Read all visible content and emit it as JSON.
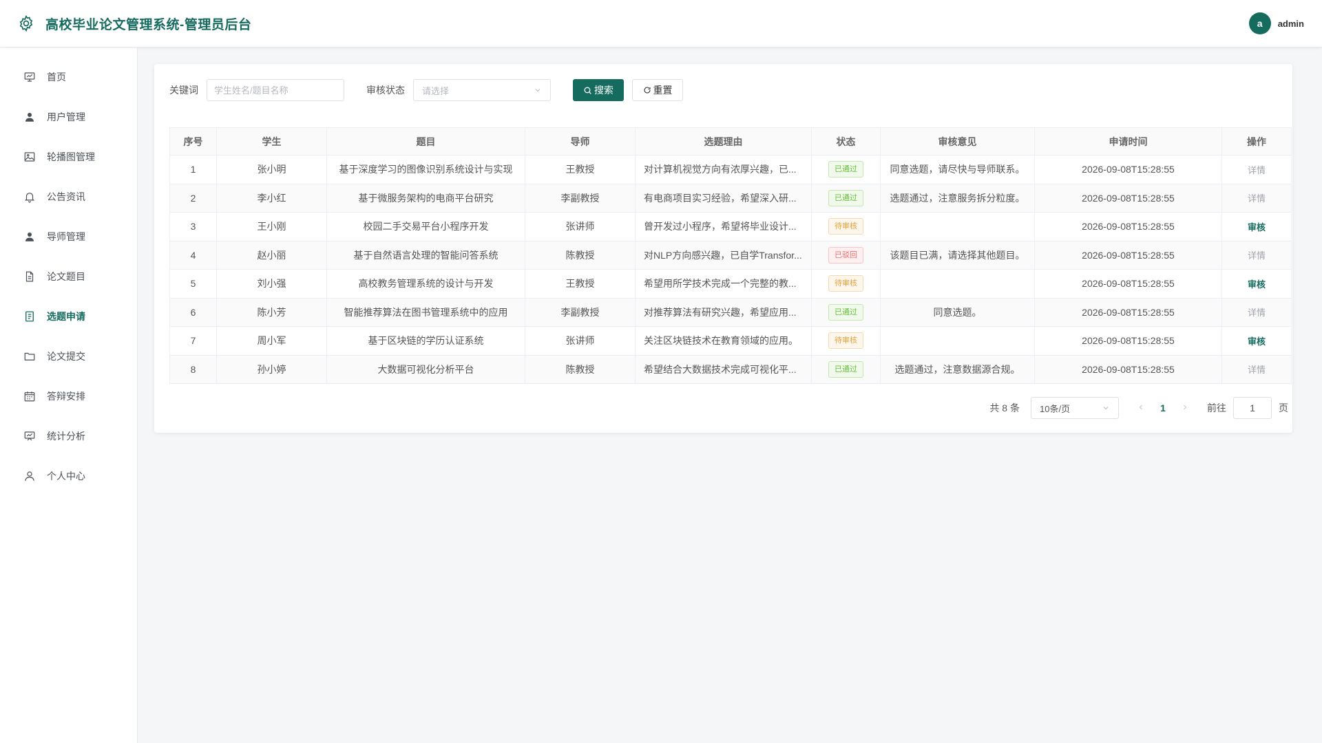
{
  "header": {
    "title": "高校毕业论文管理系统-管理员后台",
    "avatar_letter": "a",
    "username": "admin"
  },
  "sidebar": {
    "items": [
      {
        "label": "首页",
        "icon": "monitor-icon"
      },
      {
        "label": "用户管理",
        "icon": "user-icon"
      },
      {
        "label": "轮播图管理",
        "icon": "picture-icon"
      },
      {
        "label": "公告资讯",
        "icon": "bell-icon"
      },
      {
        "label": "导师管理",
        "icon": "user-icon"
      },
      {
        "label": "论文题目",
        "icon": "document-icon"
      },
      {
        "label": "选题申请",
        "icon": "list-document-icon",
        "active": true
      },
      {
        "label": "论文提交",
        "icon": "folder-icon"
      },
      {
        "label": "答辩安排",
        "icon": "calendar-icon"
      },
      {
        "label": "统计分析",
        "icon": "chart-board-icon"
      },
      {
        "label": "个人中心",
        "icon": "person-icon"
      }
    ]
  },
  "filters": {
    "keyword_label": "关键词",
    "keyword_placeholder": "学生姓名/题目名称",
    "keyword_value": "",
    "status_label": "审核状态",
    "status_placeholder": "请选择",
    "search_label": "搜索",
    "reset_label": "重置"
  },
  "table": {
    "columns": [
      "序号",
      "学生",
      "题目",
      "导师",
      "选题理由",
      "状态",
      "审核意见",
      "申请时间",
      "操作"
    ],
    "rows": [
      {
        "no": "1",
        "student": "张小明",
        "topic": "基于深度学习的图像识别系统设计与实现",
        "advisor": "王教授",
        "reason": "对计算机视觉方向有浓厚兴趣，已...",
        "status": "已通过",
        "status_type": "ok",
        "opinion": "同意选题，请尽快与导师联系。",
        "time": "2026-09-08T15:28:55",
        "action": "详情",
        "action_type": "detail"
      },
      {
        "no": "2",
        "student": "李小红",
        "topic": "基于微服务架构的电商平台研究",
        "advisor": "李副教授",
        "reason": "有电商项目实习经验，希望深入研...",
        "status": "已通过",
        "status_type": "ok",
        "opinion": "选题通过，注意服务拆分粒度。",
        "time": "2026-09-08T15:28:55",
        "action": "详情",
        "action_type": "detail"
      },
      {
        "no": "3",
        "student": "王小刚",
        "topic": "校园二手交易平台小程序开发",
        "advisor": "张讲师",
        "reason": "曾开发过小程序，希望将毕业设计...",
        "status": "待审核",
        "status_type": "wait",
        "opinion": "",
        "time": "2026-09-08T15:28:55",
        "action": "审核",
        "action_type": "review"
      },
      {
        "no": "4",
        "student": "赵小丽",
        "topic": "基于自然语言处理的智能问答系统",
        "advisor": "陈教授",
        "reason": "对NLP方向感兴趣，已自学Transfor...",
        "status": "已驳回",
        "status_type": "rej",
        "opinion": "该题目已满，请选择其他题目。",
        "time": "2026-09-08T15:28:55",
        "action": "详情",
        "action_type": "detail"
      },
      {
        "no": "5",
        "student": "刘小强",
        "topic": "高校教务管理系统的设计与开发",
        "advisor": "王教授",
        "reason": "希望用所学技术完成一个完整的教...",
        "status": "待审核",
        "status_type": "wait",
        "opinion": "",
        "time": "2026-09-08T15:28:55",
        "action": "审核",
        "action_type": "review"
      },
      {
        "no": "6",
        "student": "陈小芳",
        "topic": "智能推荐算法在图书管理系统中的应用",
        "advisor": "李副教授",
        "reason": "对推荐算法有研究兴趣，希望应用...",
        "status": "已通过",
        "status_type": "ok",
        "opinion": "同意选题。",
        "time": "2026-09-08T15:28:55",
        "action": "详情",
        "action_type": "detail"
      },
      {
        "no": "7",
        "student": "周小军",
        "topic": "基于区块链的学历认证系统",
        "advisor": "张讲师",
        "reason": "关注区块链技术在教育领域的应用。",
        "status": "待审核",
        "status_type": "wait",
        "opinion": "",
        "time": "2026-09-08T15:28:55",
        "action": "审核",
        "action_type": "review"
      },
      {
        "no": "8",
        "student": "孙小婷",
        "topic": "大数据可视化分析平台",
        "advisor": "陈教授",
        "reason": "希望结合大数据技术完成可视化平...",
        "status": "已通过",
        "status_type": "ok",
        "opinion": "选题通过，注意数据源合规。",
        "time": "2026-09-08T15:28:55",
        "action": "详情",
        "action_type": "detail"
      }
    ]
  },
  "pagination": {
    "total_text": "共 8 条",
    "page_size": "10条/页",
    "current_page": "1",
    "goto_label": "前往",
    "goto_value": "1",
    "page_unit": "页"
  },
  "colors": {
    "primary": "#156b5e",
    "success": "#67c23a",
    "warning": "#e6a23c",
    "danger": "#f56c6c"
  }
}
